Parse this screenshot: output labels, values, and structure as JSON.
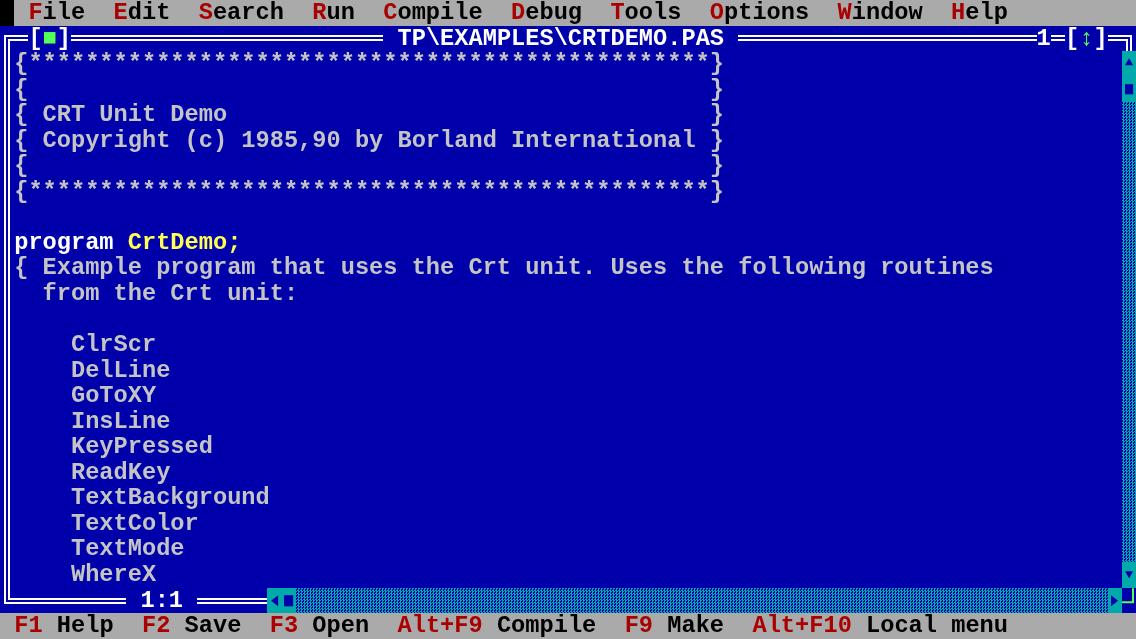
{
  "menu_bar": [
    {
      "hotkey": "F",
      "rest": "ile"
    },
    {
      "hotkey": "E",
      "rest": "dit"
    },
    {
      "hotkey": "S",
      "rest": "earch"
    },
    {
      "hotkey": "R",
      "rest": "un"
    },
    {
      "hotkey": "C",
      "rest": "ompile"
    },
    {
      "hotkey": "D",
      "rest": "ebug"
    },
    {
      "hotkey": "T",
      "rest": "ools"
    },
    {
      "hotkey": "O",
      "rest": "ptions"
    },
    {
      "hotkey": "W",
      "rest": "indow"
    },
    {
      "hotkey": "H",
      "rest": "elp"
    }
  ],
  "editor": {
    "close_button": "[■]",
    "title": "TP\\EXAMPLES\\CRTDEMO.PAS",
    "window_number": "1",
    "zoom_button": "[↕]",
    "cursor_position": "1:1",
    "lines": [
      {
        "kind": "comment",
        "text": "{************************************************}"
      },
      {
        "kind": "comment",
        "text": "{                                                }"
      },
      {
        "kind": "comment",
        "text": "{ CRT Unit Demo                                  }"
      },
      {
        "kind": "comment",
        "text": "{ Copyright (c) 1985,90 by Borland International }"
      },
      {
        "kind": "comment",
        "text": "{                                                }"
      },
      {
        "kind": "comment",
        "text": "{************************************************}"
      },
      {
        "kind": "blank"
      },
      {
        "kind": "program",
        "keyword": "program",
        "name": "CrtDemo;"
      },
      {
        "kind": "comment",
        "text": "{ Example program that uses the Crt unit. Uses the following routines"
      },
      {
        "kind": "comment",
        "text": "  from the Crt unit:"
      },
      {
        "kind": "blank"
      },
      {
        "kind": "comment",
        "text": "    ClrScr"
      },
      {
        "kind": "comment",
        "text": "    DelLine"
      },
      {
        "kind": "comment",
        "text": "    GoToXY"
      },
      {
        "kind": "comment",
        "text": "    InsLine"
      },
      {
        "kind": "comment",
        "text": "    KeyPressed"
      },
      {
        "kind": "comment",
        "text": "    ReadKey"
      },
      {
        "kind": "comment",
        "text": "    TextBackground"
      },
      {
        "kind": "comment",
        "text": "    TextColor"
      },
      {
        "kind": "comment",
        "text": "    TextMode"
      },
      {
        "kind": "comment",
        "text": "    WhereX"
      }
    ]
  },
  "status_bar": [
    {
      "key": "F1",
      "label": "Help"
    },
    {
      "key": "F2",
      "label": "Save"
    },
    {
      "key": "F3",
      "label": "Open"
    },
    {
      "key": "Alt+F9",
      "label": "Compile"
    },
    {
      "key": "F9",
      "label": "Make"
    },
    {
      "key": "Alt+F10",
      "label": "Local menu"
    }
  ]
}
